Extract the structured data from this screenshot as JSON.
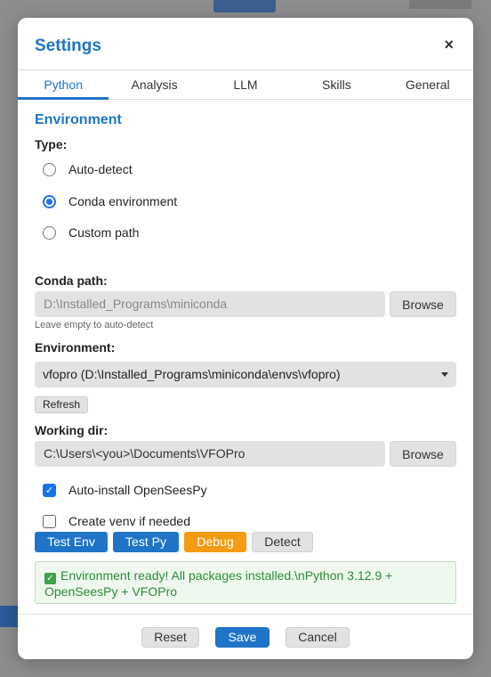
{
  "dialog": {
    "title": "Settings",
    "close_label": "×"
  },
  "tabs": [
    {
      "label": "Python",
      "active": true
    },
    {
      "label": "Analysis",
      "active": false
    },
    {
      "label": "LLM",
      "active": false
    },
    {
      "label": "Skills",
      "active": false
    },
    {
      "label": "General",
      "active": false
    }
  ],
  "environment": {
    "section_title": "Environment",
    "type_label": "Type:",
    "types": [
      {
        "label": "Auto-detect",
        "checked": false
      },
      {
        "label": "Conda environment",
        "checked": true
      },
      {
        "label": "Custom path",
        "checked": false
      }
    ],
    "conda_path_label": "Conda path:",
    "conda_path_placeholder": "D:\\Installed_Programs\\miniconda",
    "browse_label": "Browse",
    "conda_hint": "Leave empty to auto-detect",
    "environment_label": "Environment:",
    "environment_value": "vfopro (D:\\Installed_Programs\\miniconda\\envs\\vfopro)",
    "refresh_label": "Refresh",
    "working_dir_label": "Working dir:",
    "working_dir_value": "C:\\Users\\<you>\\Documents\\VFOPro",
    "auto_install_label": "Auto-install OpenSeesPy",
    "auto_install_checked": true,
    "create_venv_label": "Create venv if needed",
    "create_venv_checked": false
  },
  "actions": {
    "test_env": "Test Env",
    "test_py": "Test Py",
    "debug": "Debug",
    "detect": "Detect"
  },
  "status": {
    "message": "Environment ready! All packages installed.\\nPython 3.12.9 + OpenSeesPy + VFOPro",
    "icon": "check-icon",
    "color": "#2e8b3a"
  },
  "footer": {
    "reset": "Reset",
    "save": "Save",
    "cancel": "Cancel"
  },
  "colors": {
    "accent": "#1f74c8",
    "debug": "#f39c12"
  }
}
